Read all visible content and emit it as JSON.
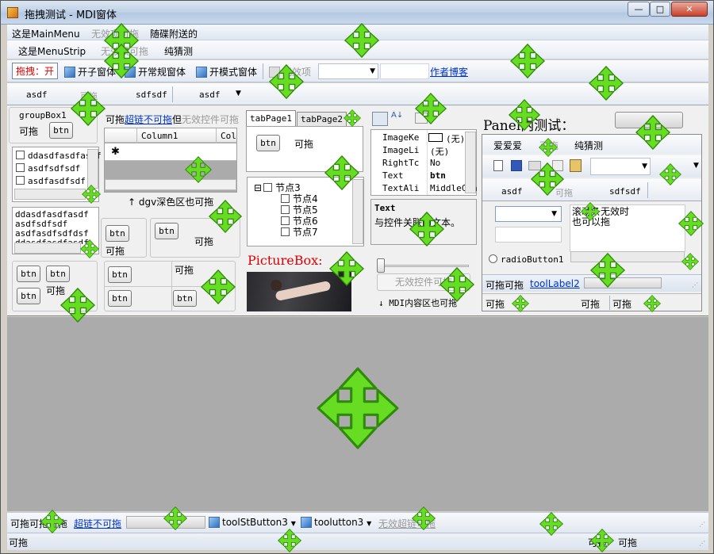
{
  "window": {
    "title": "拖拽测试 - MDI窗体",
    "min_label": "—",
    "max_label": "□",
    "close_label": "✕"
  },
  "menu": {
    "main": "这是MainMenu",
    "invalid": "无效项可拖",
    "accessory": "随碟附送的"
  },
  "menustrip": {
    "label": "这是MenuStrip",
    "invalid": "无效项可拖",
    "guess": "纯猜测"
  },
  "toolbar": {
    "drag_toggle": "拖拽：开",
    "open_child": "开子窗体",
    "open_normal": "开常规窗体",
    "open_modal": "开模式窗体",
    "invalid_item": "无效项",
    "author_blog": "作者博客"
  },
  "tabbar": {
    "tab1": "asdf",
    "tab2": "可拖",
    "tab3": "sdfsdf",
    "tab4": "asdf"
  },
  "groupbox1": {
    "title": "groupBox1",
    "drag_label": "可拖",
    "btn": "btn"
  },
  "checked_list": [
    "ddasdfasdfasdf",
    "asdfsdfsdf",
    "asdfasdfsdf"
  ],
  "textlist": [
    "ddasdfasdfasdf",
    "asdfsdfsdf",
    "asdfasdfsdfdsf",
    "ddasdfasdfasdf"
  ],
  "small_panels": {
    "btn": "btn",
    "drag": "可拖"
  },
  "header_row": {
    "drag_prefix": "可拖",
    "link": "超链不可拖",
    "suffix": "但",
    "invalid": "无效控件可拖"
  },
  "grid": {
    "columns": [
      "Column1",
      "Col"
    ],
    "new_row_marker": "✱",
    "caption": "↑ dgv深色区也可拖"
  },
  "tabcontrol": {
    "tabs": [
      "tabPage1",
      "tabPage2"
    ],
    "btn": "btn",
    "drag": "可拖"
  },
  "tree": {
    "root": "节点3",
    "children": [
      "节点4",
      "节点5",
      "节点6",
      "节点7"
    ]
  },
  "picture": {
    "label": "PictureBox:"
  },
  "propgrid": {
    "rows": [
      {
        "key": "ImageKe",
        "value": "(无)"
      },
      {
        "key": "ImageLi",
        "value": "(无)"
      },
      {
        "key": "RightTc",
        "value": "No"
      },
      {
        "key": "Text",
        "value": "btn"
      },
      {
        "key": "TextAli",
        "value": "MiddleCen"
      }
    ],
    "desc_title": "Text",
    "desc_body": "与控件关联的文本。"
  },
  "trackbar_area": {
    "disabled_btn": "无效控件可拖",
    "mdi_note": "↓ MDI内容区也可拖"
  },
  "panel": {
    "title": "Panel内测试：",
    "menu": [
      "爱爱爱",
      "可拖",
      "纯猜测"
    ],
    "tabs": [
      "asdf",
      "可拖",
      "sdfsdf"
    ],
    "text_area": "滚动条无效时\n也可以拖",
    "radio": "radioButton1",
    "status_label": "可拖可拖",
    "tool_label": "toolLabel2",
    "bottom_labels": [
      "可拖",
      "可拖",
      "可拖"
    ]
  },
  "bottom_strip": {
    "label": "可拖可拖可拖",
    "link": "超链不可拖",
    "btn3": "toolStButton3",
    "btn4": "toolutton3",
    "invalid_link": "无效超链可拖"
  },
  "status_strip": {
    "left": "可拖",
    "right1": "可拖",
    "right2": "可拖"
  },
  "colors": {
    "move_icon": "#66dd22",
    "mdi_bg": "#ababab",
    "link": "#0033cc",
    "picture_label": "#dd0000"
  },
  "icons": [
    "move-icon",
    "app-icon",
    "image-icon",
    "printer-icon",
    "sort-az-icon",
    "new-doc-icon",
    "save-icon",
    "copy-icon",
    "paste-icon"
  ]
}
